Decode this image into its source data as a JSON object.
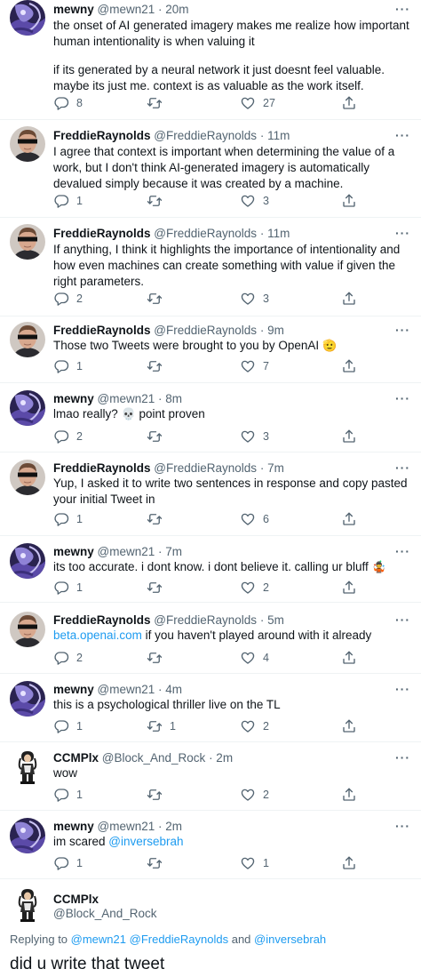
{
  "tweets": [
    {
      "name": "mewny",
      "handle": "@mewn21",
      "time": "· 20m",
      "lines": [
        "the onset of AI generated imagery makes me realize how important human intentionality is when valuing it",
        "",
        "if its generated by a neural network it just doesnt feel valuable. maybe its just me. context is as valuable as the work itself."
      ],
      "reply_count": "8",
      "retweet_count": "",
      "like_count": "27"
    },
    {
      "name": "FreddieRaynolds",
      "handle": "@FreddieRaynolds",
      "time": "· 11m",
      "text": "I agree that context is important when determining the value of a work, but I don't think AI-generated imagery is automatically devalued simply because it was created by a machine.",
      "reply_count": "1",
      "retweet_count": "",
      "like_count": "3"
    },
    {
      "name": "FreddieRaynolds",
      "handle": "@FreddieRaynolds",
      "time": "· 11m",
      "text": "If anything, I think it highlights the importance of intentionality and how even machines can create something with value if given the right parameters.",
      "reply_count": "2",
      "retweet_count": "",
      "like_count": "3"
    },
    {
      "name": "FreddieRaynolds",
      "handle": "@FreddieRaynolds",
      "time": "· 9m",
      "text": "Those two Tweets were brought to you by OpenAI",
      "emoji": "🫡",
      "reply_count": "1",
      "retweet_count": "",
      "like_count": "7"
    },
    {
      "name": "mewny",
      "handle": "@mewn21",
      "time": "· 8m",
      "text_before": "lmao really?",
      "emoji": "💀",
      "text_after": "point proven",
      "reply_count": "2",
      "retweet_count": "",
      "like_count": "3"
    },
    {
      "name": "FreddieRaynolds",
      "handle": "@FreddieRaynolds",
      "time": "· 7m",
      "text": "Yup, I asked it to write two sentences in response and copy pasted your initial Tweet in",
      "reply_count": "1",
      "retweet_count": "",
      "like_count": "6"
    },
    {
      "name": "mewny",
      "handle": "@mewn21",
      "time": "· 7m",
      "text": "its too accurate. i dont know. i dont believe it. calling ur bluff",
      "emoji": "🤹",
      "reply_count": "1",
      "retweet_count": "",
      "like_count": "2"
    },
    {
      "name": "FreddieRaynolds",
      "handle": "@FreddieRaynolds",
      "time": "· 5m",
      "link": "beta.openai.com",
      "text": " if you haven't played around with it already",
      "reply_count": "2",
      "retweet_count": "",
      "like_count": "4"
    },
    {
      "name": "mewny",
      "handle": "@mewn21",
      "time": "· 4m",
      "text": "this is a psychological thriller live on the TL",
      "reply_count": "1",
      "retweet_count": "1",
      "like_count": "2"
    },
    {
      "name": "CCMPlx",
      "handle": "@Block_And_Rock",
      "time": "· 2m",
      "text": "wow",
      "reply_count": "1",
      "retweet_count": "",
      "like_count": "2"
    },
    {
      "name": "mewny",
      "handle": "@mewn21",
      "time": "· 2m",
      "text": "im scared ",
      "link": "@inversebrah",
      "reply_count": "1",
      "retweet_count": "",
      "like_count": "1"
    }
  ],
  "main_tweet": {
    "name": "CCMPlx",
    "handle": "@Block_And_Rock",
    "replying_prefix": "Replying to ",
    "replying_to_1": "@mewn21",
    "replying_to_2": "@FreddieRaynolds",
    "replying_and": " and ",
    "replying_to_3": "@inversebrah",
    "text": "did u write that tweet"
  },
  "more_label": "···",
  "icons": [
    "reply-icon",
    "retweet-icon",
    "like-icon",
    "share-icon",
    "more-icon"
  ],
  "colors": {
    "text": "#0f1419",
    "secondary": "#536471",
    "link": "#1d9bf0",
    "divider": "#eff3f4"
  }
}
